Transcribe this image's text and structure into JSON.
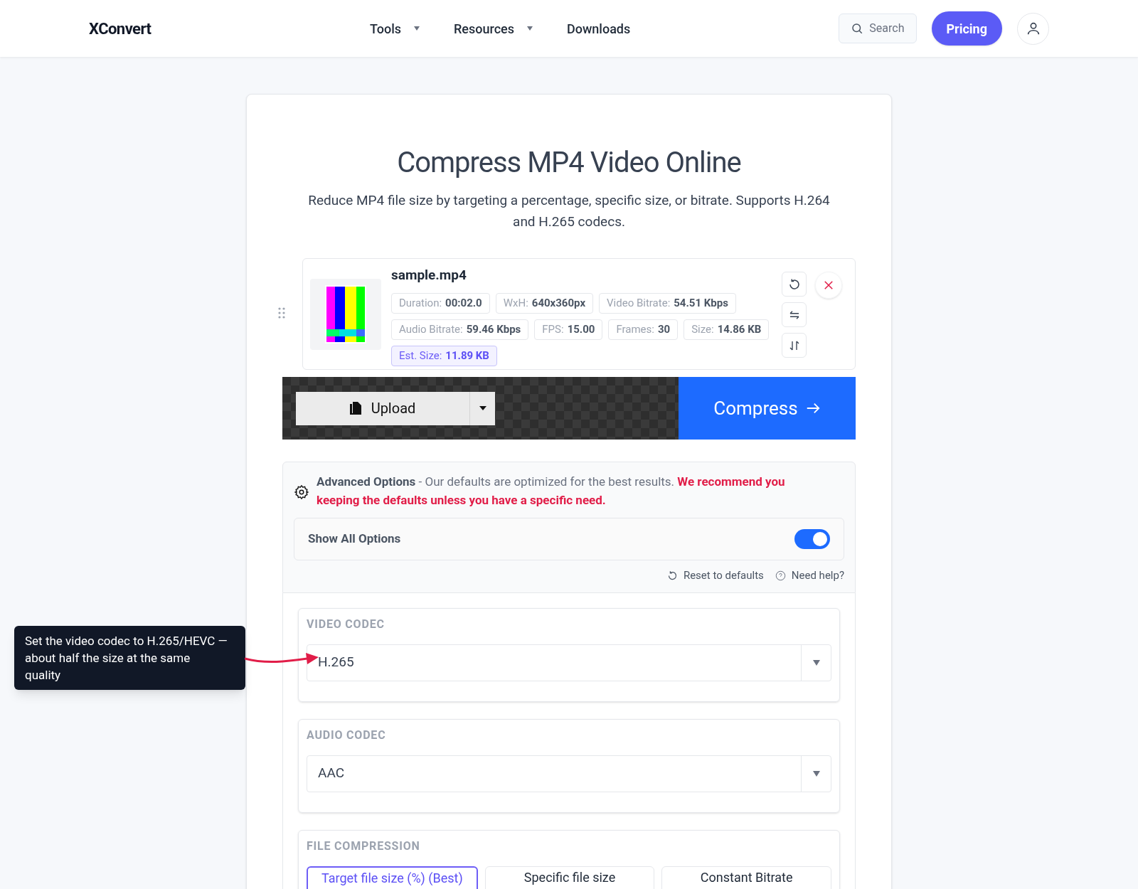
{
  "header": {
    "logo": "XConvert",
    "nav": [
      {
        "label": "Tools",
        "dropdown": true
      },
      {
        "label": "Resources",
        "dropdown": true
      },
      {
        "label": "Downloads",
        "dropdown": false
      }
    ],
    "search": "Search",
    "pricing": "Pricing"
  },
  "title": "Compress MP4 Video Online",
  "subtitle": "Reduce MP4 file size by targeting a percentage, specific size, or bitrate. Supports H.264 and H.265 codecs.",
  "file": {
    "name": "sample.mp4",
    "meta": [
      {
        "label": "Duration:",
        "value": "00:02.0",
        "highlighted": false
      },
      {
        "label": "WxH:",
        "value": "640x360px",
        "highlighted": false
      },
      {
        "label": "Video Bitrate:",
        "value": "54.51 Kbps",
        "highlighted": false
      },
      {
        "label": "Audio Bitrate:",
        "value": "59.46 Kbps",
        "highlighted": false
      },
      {
        "label": "FPS:",
        "value": "15.00",
        "highlighted": false
      },
      {
        "label": "Frames:",
        "value": "30",
        "highlighted": false
      },
      {
        "label": "Size:",
        "value": "14.86 KB",
        "highlighted": false
      },
      {
        "label": "Est. Size:",
        "value": "11.89 KB",
        "highlighted": true
      }
    ]
  },
  "upload": "Upload",
  "compress": "Compress",
  "advanced": {
    "heading": "Advanced Options",
    "text": " - Our defaults are optimized for the best results. ",
    "warning": "We recommend you keeping the defaults unless you have a specific need.",
    "show_all": {
      "label": "Show All Options",
      "on": true
    },
    "reset": "Reset to defaults",
    "help": "Need help?"
  },
  "sections": [
    {
      "kind": "select",
      "label": "VIDEO CODEC",
      "value": "H.265"
    },
    {
      "kind": "select",
      "label": "AUDIO CODEC",
      "value": "AAC"
    },
    {
      "kind": "segmented",
      "label": "FILE COMPRESSION",
      "options": [
        {
          "label": "Target file size (%) (Best)",
          "selected": true
        },
        {
          "label": "Specific file size",
          "selected": false
        },
        {
          "label": "Constant Bitrate",
          "selected": false
        }
      ]
    }
  ],
  "tooltip": "Set the video codec to H.265/HEVC — about half the size at the same quality"
}
